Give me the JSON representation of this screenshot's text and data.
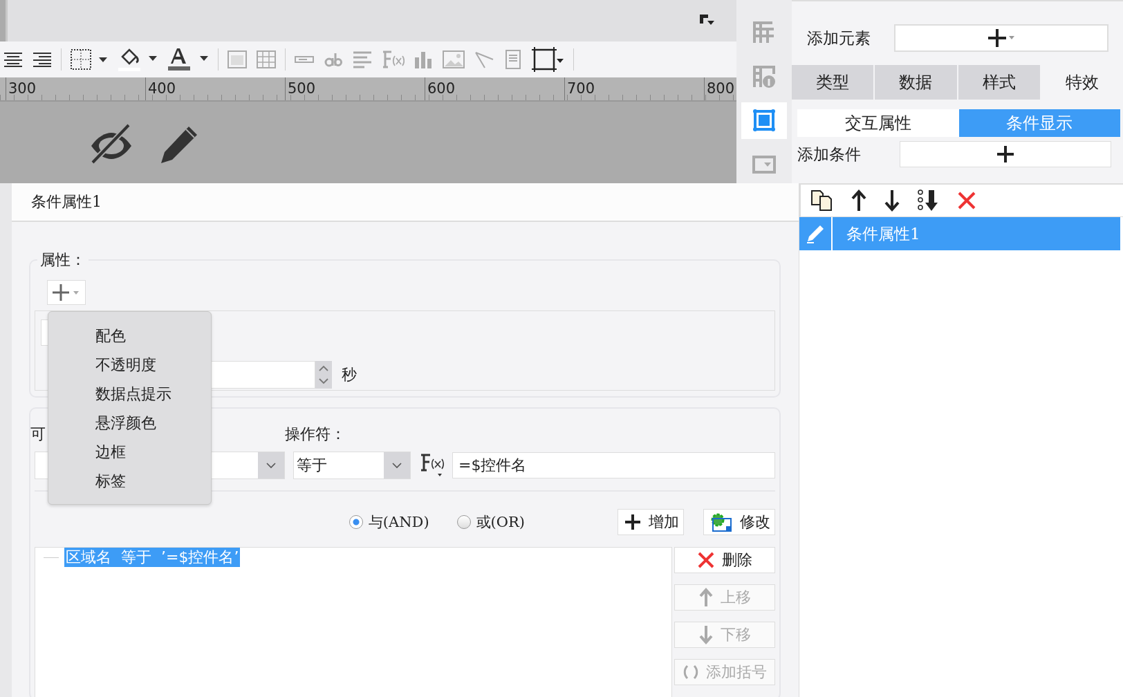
{
  "ruler": {
    "labels": [
      "300",
      "400",
      "500",
      "600",
      "700",
      "800"
    ]
  },
  "side_icons": [
    {
      "selected": false
    },
    {
      "selected": false
    },
    {
      "selected": true
    },
    {
      "selected": false
    }
  ],
  "right_panel": {
    "add_element_label": "添加元素",
    "tabs": [
      {
        "label": "类型",
        "selected": false
      },
      {
        "label": "数据",
        "selected": false
      },
      {
        "label": "样式",
        "selected": false
      },
      {
        "label": "特效",
        "selected": true
      }
    ],
    "subtabs": [
      {
        "label": "交互属性",
        "selected": false
      },
      {
        "label": "条件显示",
        "selected": true
      }
    ],
    "add_condition_label": "添加条件",
    "conditions": [
      {
        "label": "条件属性1",
        "selected": true
      }
    ]
  },
  "dialog": {
    "title": "条件属性1",
    "attributes": {
      "legend": "属性：",
      "unit": "秒",
      "menu": [
        "配色",
        "不透明度",
        "数据点提示",
        "悬浮颜色",
        "边框",
        "标签"
      ]
    },
    "condition": {
      "column_label": "可",
      "operator_label": "操作符：",
      "operator_value": "等于",
      "value": "=$控件名",
      "logic": [
        {
          "label": "与(AND)",
          "selected": true
        },
        {
          "label": "或(OR)",
          "selected": false
        }
      ],
      "add_button": "增加",
      "modify_button": "修改",
      "tree": [
        {
          "label": "区域名  等于  ’=$控件名’",
          "selected": true
        }
      ],
      "actions": [
        {
          "label": "删除",
          "kind": "delete",
          "disabled": false
        },
        {
          "label": "上移",
          "kind": "up",
          "disabled": true
        },
        {
          "label": "下移",
          "kind": "down",
          "disabled": true
        },
        {
          "label": "添加括号",
          "kind": "bracket",
          "disabled": true
        }
      ]
    }
  }
}
